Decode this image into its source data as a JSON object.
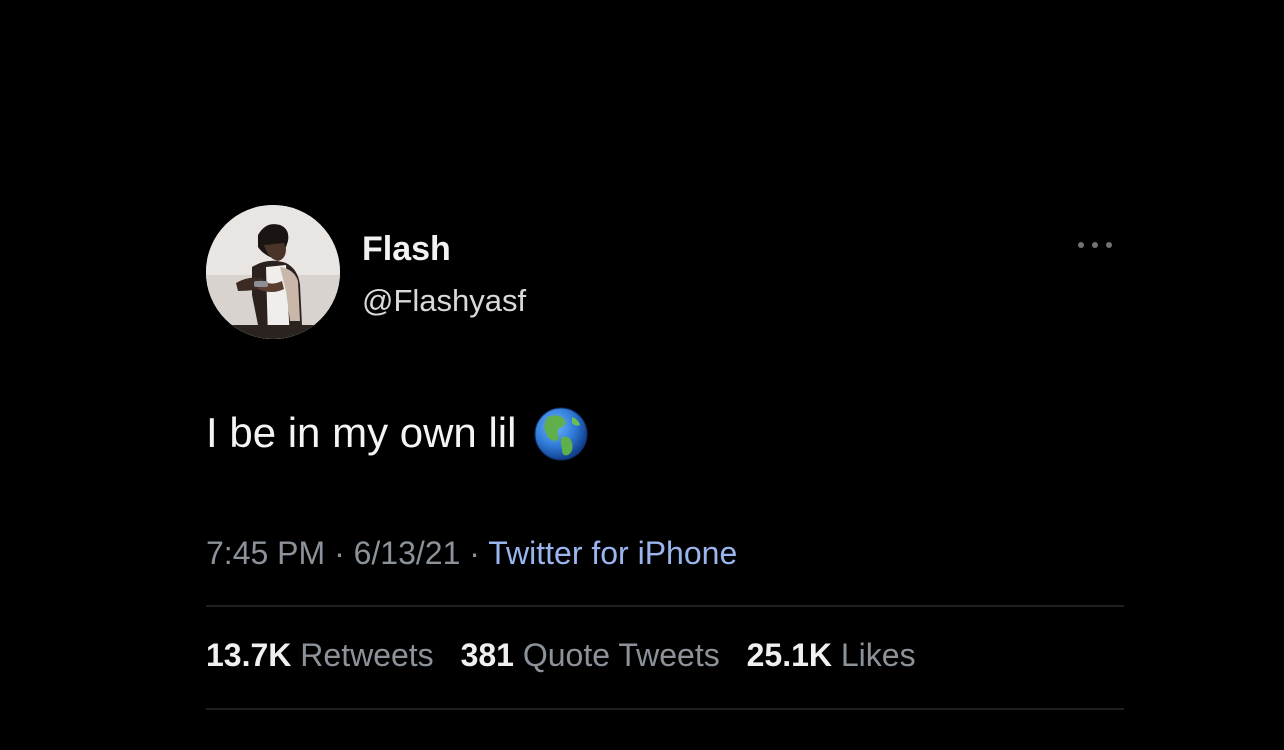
{
  "tweet": {
    "author": {
      "name": "Flash",
      "handle": "@Flashyasf"
    },
    "text": "I be in my own lil",
    "emoji_icon": "globe-americas-icon",
    "time": "7:45 PM",
    "date": "6/13/21",
    "separator": "·",
    "source": "Twitter for iPhone",
    "stats": {
      "retweets_count": "13.7K",
      "retweets_label": "Retweets",
      "quote_count": "381",
      "quote_label": "Quote Tweets",
      "likes_count": "25.1K",
      "likes_label": "Likes"
    }
  },
  "colors": {
    "background": "#000000",
    "primary_text": "#f2f2f2",
    "secondary_text": "#8b9299",
    "source_link": "#9ab5ee",
    "divider": "#1d2023"
  }
}
